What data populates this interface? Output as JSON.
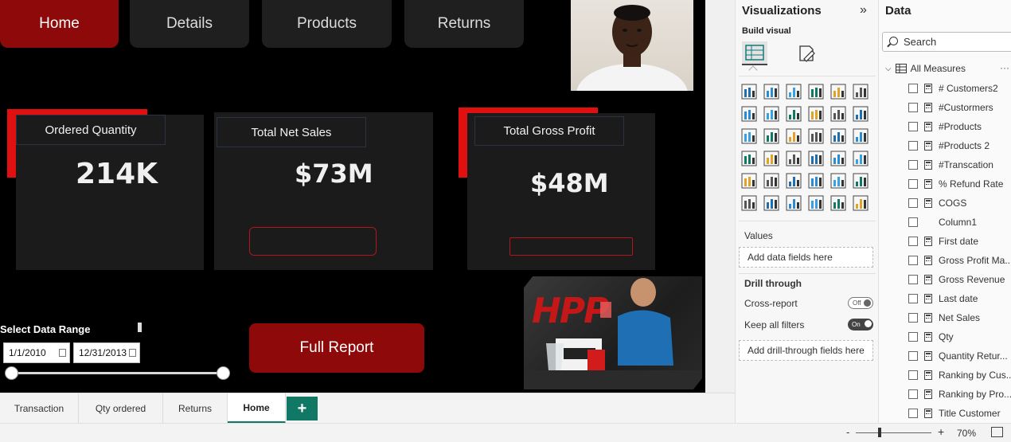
{
  "nav": [
    {
      "label": "Home",
      "active": true
    },
    {
      "label": "Details",
      "active": false
    },
    {
      "label": "Products",
      "active": false
    },
    {
      "label": "Returns",
      "active": false
    }
  ],
  "kpis": [
    {
      "title": "Ordered Quantity",
      "value": "214K"
    },
    {
      "title": "Total Net Sales",
      "value": "$73M"
    },
    {
      "title": "Total Gross Profit",
      "value": "$48M"
    }
  ],
  "date_range": {
    "title": "Select Data Range",
    "start": "1/1/2010",
    "end": "12/31/2013"
  },
  "full_report_label": "Full Report",
  "promo_text": "HPP",
  "page_tabs": [
    {
      "label": "Transaction",
      "active": false
    },
    {
      "label": "Qty ordered",
      "active": false
    },
    {
      "label": "Returns",
      "active": false
    },
    {
      "label": "Home",
      "active": true
    }
  ],
  "add_page": "+",
  "visualizations": {
    "title": "Visualizations",
    "build_visual": "Build visual",
    "values_label": "Values",
    "values_placeholder": "Add data fields here",
    "drill_through": "Drill through",
    "cross_report": "Cross-report",
    "cross_report_state": "Off",
    "keep_filters": "Keep all filters",
    "keep_filters_state": "On",
    "drill_placeholder": "Add drill-through fields here",
    "icons": [
      "stacked-bar-chart-icon",
      "stacked-column-chart-icon",
      "clustered-bar-chart-icon",
      "clustered-column-chart-icon",
      "100-bar-chart-icon",
      "100-column-chart-icon",
      "line-chart-icon",
      "area-chart-icon",
      "stacked-area-chart-icon",
      "line-column-chart-icon",
      "line-stacked-column-icon",
      "ribbon-chart-icon",
      "waterfall-chart-icon",
      "funnel-chart-icon",
      "scatter-chart-icon",
      "pie-chart-icon",
      "donut-chart-icon",
      "treemap-icon",
      "map-icon",
      "filled-map-icon",
      "gauge-icon",
      "card-icon",
      "multi-row-card-icon",
      "kpi-icon",
      "slicer-icon",
      "table-icon",
      "matrix-icon",
      "r-visual-icon",
      "python-visual-icon",
      "key-influencers-icon",
      "decomposition-tree-icon",
      "qa-icon",
      "paginated-report-icon",
      "trophy-icon",
      "smart-narrative-icon",
      "more-visuals-icon"
    ]
  },
  "data": {
    "title": "Data",
    "search_placeholder": "Search",
    "table_name": "All Measures",
    "fields": [
      {
        "name": "# Customers2",
        "measure": true
      },
      {
        "name": "#Custormers",
        "measure": true
      },
      {
        "name": "#Products",
        "measure": true
      },
      {
        "name": "#Products 2",
        "measure": true
      },
      {
        "name": "#Transcation",
        "measure": true
      },
      {
        "name": "% Refund Rate",
        "measure": true
      },
      {
        "name": "COGS",
        "measure": true
      },
      {
        "name": "Column1",
        "measure": false
      },
      {
        "name": "First date",
        "measure": true
      },
      {
        "name": "Gross Profit Ma...",
        "measure": true
      },
      {
        "name": "Gross Revenue",
        "measure": true
      },
      {
        "name": "Last date",
        "measure": true
      },
      {
        "name": "Net Sales",
        "measure": true
      },
      {
        "name": "Qty",
        "measure": true
      },
      {
        "name": "Quantity Retur...",
        "measure": true
      },
      {
        "name": "Ranking by Cus...",
        "measure": true
      },
      {
        "name": "Ranking by Pro...",
        "measure": true
      },
      {
        "name": "Title Customer",
        "measure": true
      }
    ]
  },
  "zoom": {
    "minus": "-",
    "plus": "+",
    "percent": "70%"
  },
  "colors": {
    "accent_red": "#8e0a0a",
    "bright_red": "#e01010",
    "teal": "#117865",
    "canvas": "#000000",
    "card": "#1b1b1b"
  }
}
